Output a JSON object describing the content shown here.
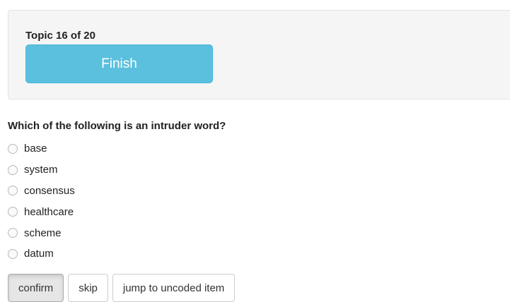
{
  "progress": {
    "label": "Topic 16 of 20",
    "finish_label": "Finish"
  },
  "question": {
    "text": "Which of the following is an intruder word?",
    "options": [
      {
        "label": "base",
        "selected": false
      },
      {
        "label": "system",
        "selected": false
      },
      {
        "label": "consensus",
        "selected": false
      },
      {
        "label": "healthcare",
        "selected": false
      },
      {
        "label": "scheme",
        "selected": false
      },
      {
        "label": "datum",
        "selected": false
      }
    ]
  },
  "actions": {
    "confirm_label": "confirm",
    "skip_label": "skip",
    "jump_label": "jump to uncoded item"
  },
  "colors": {
    "finish_button": "#5bc0de",
    "panel_background": "#f5f5f5"
  }
}
